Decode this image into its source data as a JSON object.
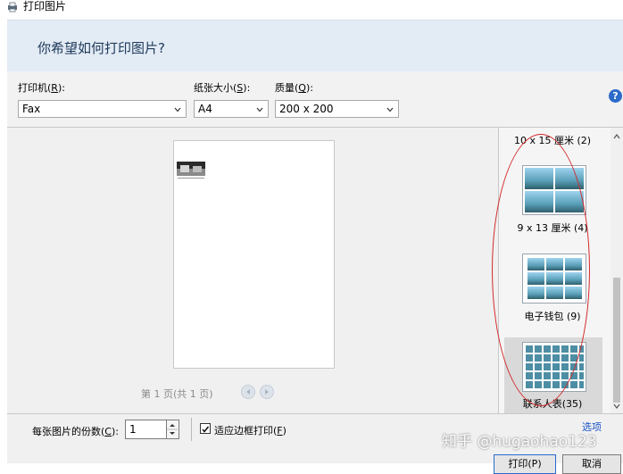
{
  "window": {
    "title": "打印图片"
  },
  "header": {
    "question": "你希望如何打印图片?"
  },
  "options": {
    "printer": {
      "label": "打印机(",
      "key": "R",
      "label_end": "):",
      "value": "Fax"
    },
    "paper_size": {
      "label": "纸张大小(",
      "key": "S",
      "label_end": "):",
      "value": "A4"
    },
    "quality": {
      "label": "质量(",
      "key": "Q",
      "label_end": "):",
      "value": "200 x 200"
    },
    "help": "?"
  },
  "preview": {
    "page_indicator": "第 1 页(共 1 页)"
  },
  "layouts": [
    {
      "label": "10 x 15 厘米 (2)",
      "grid": "partial"
    },
    {
      "label": "9 x 13 厘米 (4)",
      "grid": "2x2"
    },
    {
      "label": "电子钱包 (9)",
      "grid": "3x3"
    },
    {
      "label": "联系人表(35)",
      "grid": "5x7",
      "selected": true
    }
  ],
  "bottom": {
    "copies_label": "每张图片的份数(",
    "copies_key": "C",
    "copies_end": "):",
    "copies_value": "1",
    "fit_label": "适应边框打印(",
    "fit_key": "F",
    "fit_end": ")",
    "fit_checked": true,
    "options_link": "选项",
    "print_button": "打印(P)",
    "cancel_button": "取消"
  },
  "watermark": "知乎 @hugaohao123",
  "colors": {
    "accent": "#2c6bc9",
    "annotation": "#d32a2a",
    "header_bg": "#e3ebf5"
  }
}
